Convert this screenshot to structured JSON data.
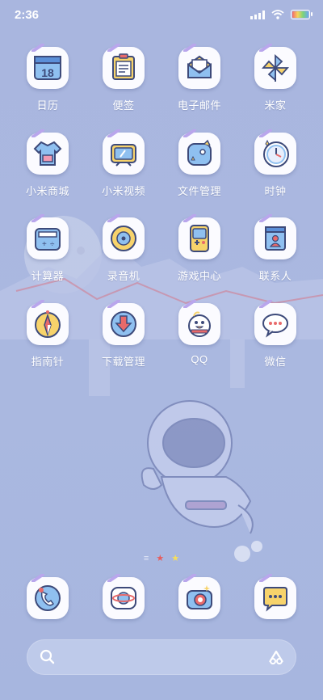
{
  "status_bar": {
    "time": "2:36"
  },
  "apps": [
    {
      "label": "日历",
      "icon": "calendar-icon",
      "day": "18"
    },
    {
      "label": "便签",
      "icon": "notes-icon"
    },
    {
      "label": "电子邮件",
      "icon": "email-icon"
    },
    {
      "label": "米家",
      "icon": "pinwheel-icon"
    },
    {
      "label": "小米商城",
      "icon": "shirt-icon"
    },
    {
      "label": "小米视频",
      "icon": "tv-icon"
    },
    {
      "label": "文件管理",
      "icon": "folder-icon"
    },
    {
      "label": "时钟",
      "icon": "clock-icon"
    },
    {
      "label": "计算器",
      "icon": "calculator-icon"
    },
    {
      "label": "录音机",
      "icon": "recorder-icon"
    },
    {
      "label": "游戏中心",
      "icon": "gameboy-icon"
    },
    {
      "label": "联系人",
      "icon": "contacts-icon"
    },
    {
      "label": "指南针",
      "icon": "compass-icon"
    },
    {
      "label": "下载管理",
      "icon": "download-icon"
    },
    {
      "label": "QQ",
      "icon": "qq-penguin-icon"
    },
    {
      "label": "微信",
      "icon": "wechat-icon"
    }
  ],
  "dock": [
    {
      "icon": "phone-icon"
    },
    {
      "icon": "browser-planet-icon"
    },
    {
      "icon": "camera-icon"
    },
    {
      "icon": "messages-icon"
    }
  ],
  "colors": {
    "accent_purple": "#b9a6ec",
    "icon_outline": "#3d4a7a"
  }
}
